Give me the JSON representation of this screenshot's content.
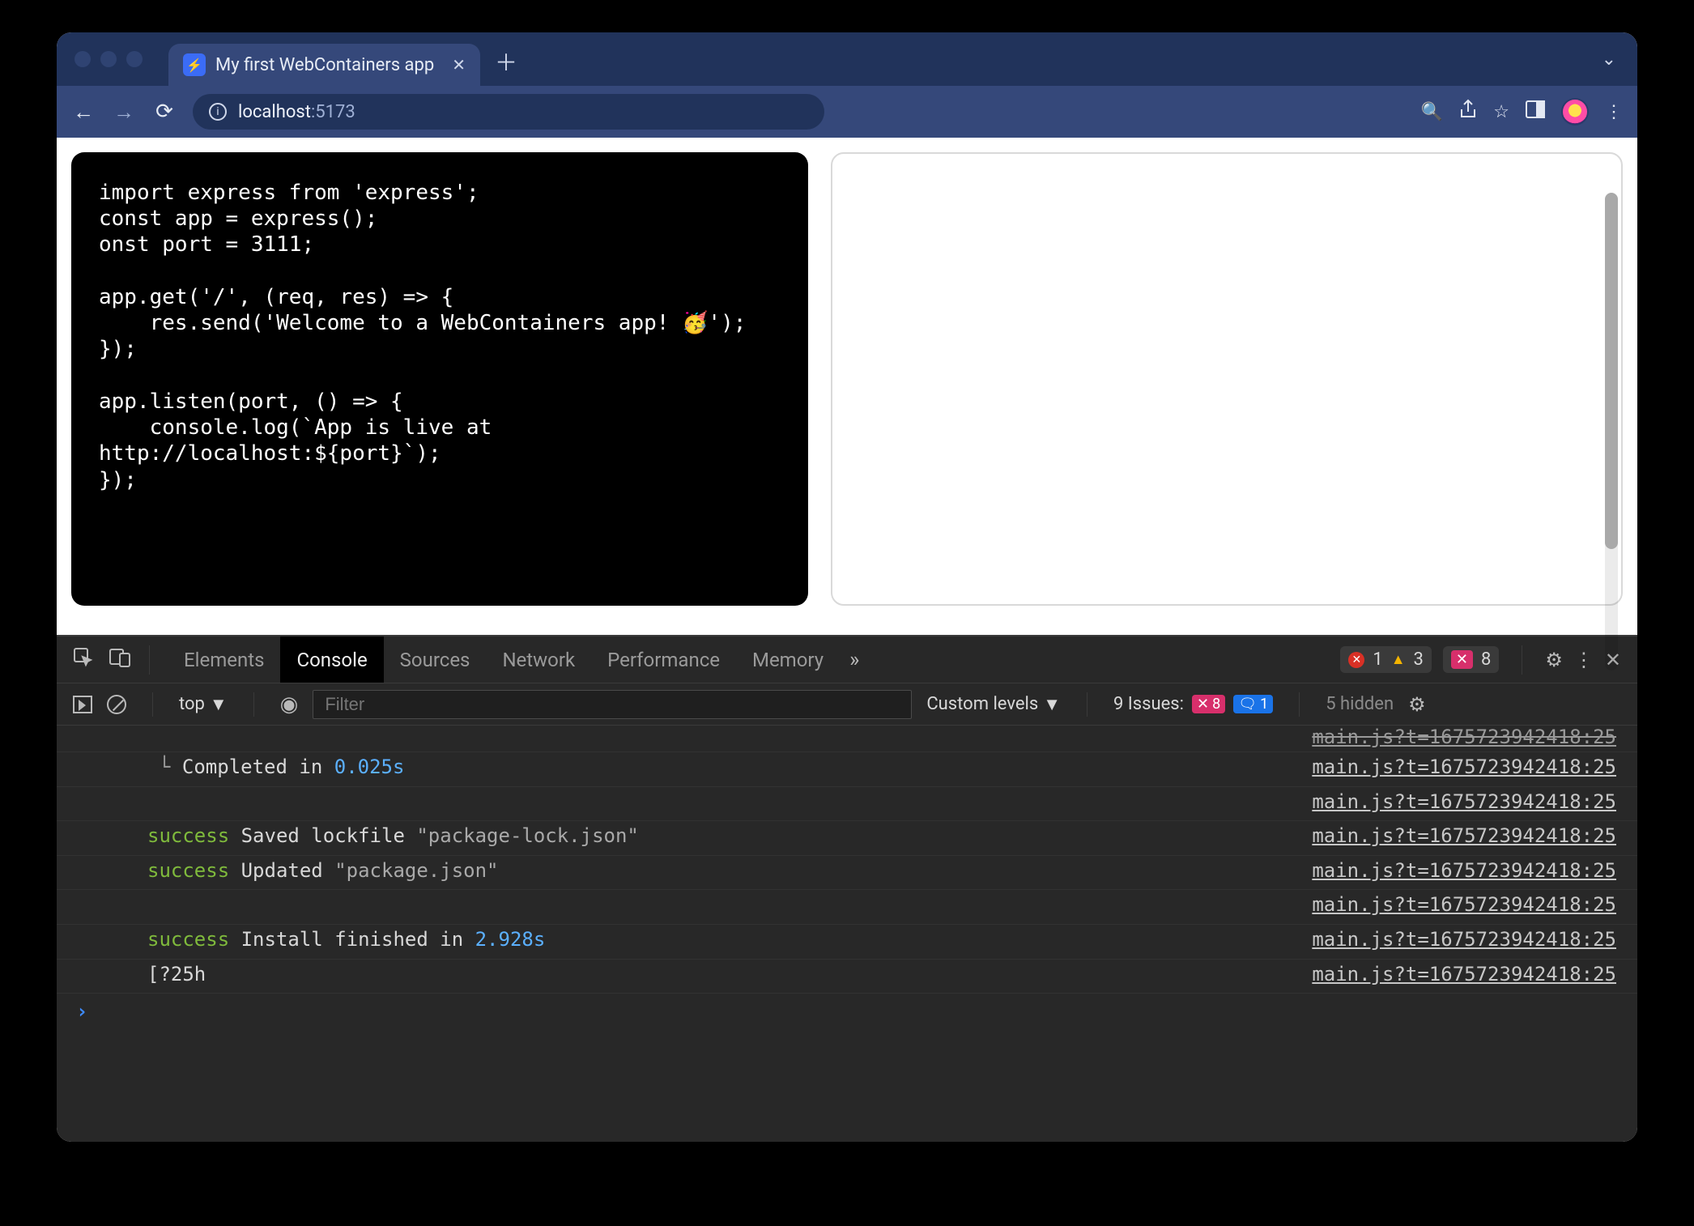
{
  "browser": {
    "tab_title": "My first WebContainers app",
    "favicon_glyph": "⚡",
    "url_host": "localhost",
    "url_port": ":5173"
  },
  "editor_code": "import express from 'express';\nconst app = express();\nonst port = 3111;\n\napp.get('/', (req, res) => {\n    res.send('Welcome to a WebContainers app! 🥳');\n});\n\napp.listen(port, () => {\n    console.log(`App is live at\nhttp://localhost:${port}`);\n});",
  "devtools": {
    "tabs": [
      "Elements",
      "Console",
      "Sources",
      "Network",
      "Performance",
      "Memory"
    ],
    "active_tab": "Console",
    "error_count": "1",
    "warn_count": "3",
    "pink_count": "8",
    "context_label": "top",
    "filter_placeholder": "Filter",
    "levels_label": "Custom levels",
    "issues_label": "9 Issues:",
    "issues_pink": "8",
    "issues_blue": "1",
    "hidden_label": "5 hidden"
  },
  "console_rows": [
    {
      "indent": true,
      "parts": [
        {
          "t": "└ ",
          "cls": "tree"
        },
        {
          "t": "Completed in ",
          "cls": ""
        },
        {
          "t": "0.025s",
          "cls": "txt-num"
        }
      ],
      "src": "main.js?t=1675723942418:25"
    },
    {
      "blank": true,
      "src": "main.js?t=1675723942418:25"
    },
    {
      "parts": [
        {
          "t": "success",
          "cls": "txt-success"
        },
        {
          "t": " Saved lockfile ",
          "cls": ""
        },
        {
          "t": "\"package-lock.json\"",
          "cls": "txt-string"
        }
      ],
      "src": "main.js?t=1675723942418:25"
    },
    {
      "parts": [
        {
          "t": "success",
          "cls": "txt-success"
        },
        {
          "t": " Updated ",
          "cls": ""
        },
        {
          "t": "\"package.json\"",
          "cls": "txt-string"
        }
      ],
      "src": "main.js?t=1675723942418:25"
    },
    {
      "blank": true,
      "src": "main.js?t=1675723942418:25"
    },
    {
      "parts": [
        {
          "t": "success",
          "cls": "txt-success"
        },
        {
          "t": " Install finished in ",
          "cls": ""
        },
        {
          "t": "2.928s",
          "cls": "txt-num"
        }
      ],
      "src": "main.js?t=1675723942418:25"
    },
    {
      "parts": [
        {
          "t": "[?25h",
          "cls": ""
        }
      ],
      "src": "main.js?t=1675723942418:25"
    }
  ],
  "truncated_src": "main.js?t=1675723942418:25"
}
